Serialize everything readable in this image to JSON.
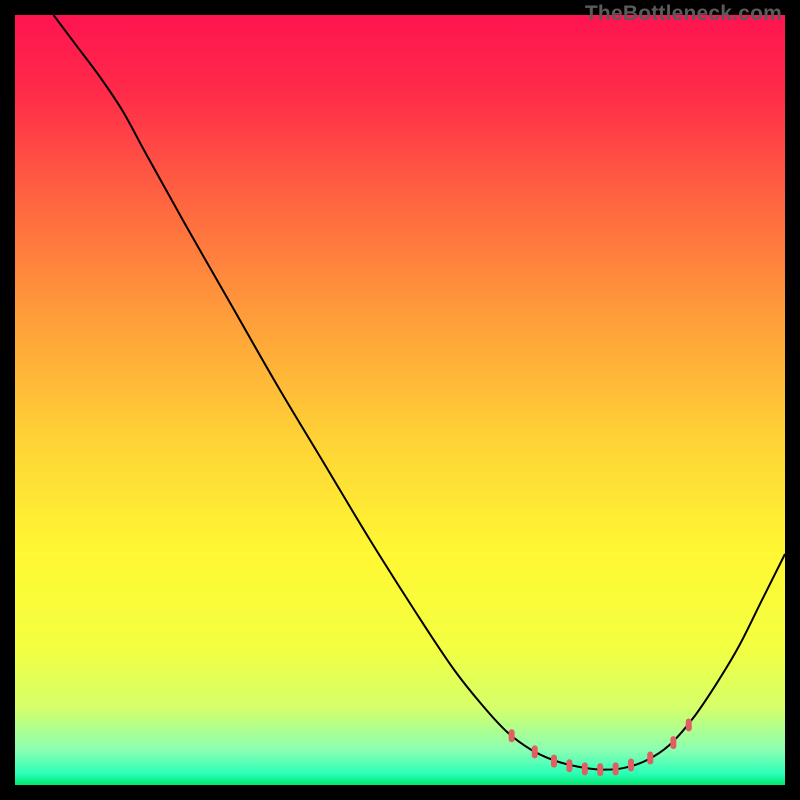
{
  "watermark": "TheBottleneck.com",
  "chart_data": {
    "type": "line",
    "title": "",
    "xlabel": "",
    "ylabel": "",
    "xlim": [
      0,
      100
    ],
    "ylim": [
      0,
      100
    ],
    "gradient_stops": [
      {
        "offset": 0.0,
        "color": "#ff1450"
      },
      {
        "offset": 0.1,
        "color": "#ff2b49"
      },
      {
        "offset": 0.25,
        "color": "#ff6840"
      },
      {
        "offset": 0.4,
        "color": "#ffa03a"
      },
      {
        "offset": 0.55,
        "color": "#ffd236"
      },
      {
        "offset": 0.7,
        "color": "#fff833"
      },
      {
        "offset": 0.82,
        "color": "#f3ff41"
      },
      {
        "offset": 0.9,
        "color": "#d4ff6a"
      },
      {
        "offset": 0.955,
        "color": "#89ffb2"
      },
      {
        "offset": 0.985,
        "color": "#2bffb8"
      },
      {
        "offset": 1.0,
        "color": "#00e86e"
      }
    ],
    "series": [
      {
        "name": "curve",
        "stroke": "#000000",
        "points_xy": [
          [
            5,
            100
          ],
          [
            8,
            96
          ],
          [
            11,
            92
          ],
          [
            14,
            87.5
          ],
          [
            17,
            82
          ],
          [
            22,
            73
          ],
          [
            28,
            62.5
          ],
          [
            34,
            52
          ],
          [
            40,
            42
          ],
          [
            46,
            32
          ],
          [
            52,
            22.5
          ],
          [
            57,
            15
          ],
          [
            61,
            10
          ],
          [
            64,
            6.8
          ],
          [
            67,
            4.6
          ],
          [
            70,
            3.2
          ],
          [
            73,
            2.4
          ],
          [
            76,
            2.0
          ],
          [
            79,
            2.2
          ],
          [
            82,
            3.2
          ],
          [
            85,
            5.2
          ],
          [
            88,
            8.6
          ],
          [
            91,
            13
          ],
          [
            94,
            18
          ],
          [
            97,
            24
          ],
          [
            100,
            30
          ]
        ]
      },
      {
        "name": "fit-band-markers",
        "stroke": "#e06062",
        "marker_r": 5,
        "points_xy": [
          [
            64.5,
            6.4
          ],
          [
            67.5,
            4.3
          ],
          [
            70,
            3.1
          ],
          [
            72,
            2.5
          ],
          [
            74,
            2.1
          ],
          [
            76,
            2.0
          ],
          [
            78,
            2.1
          ],
          [
            80,
            2.6
          ],
          [
            82.5,
            3.5
          ],
          [
            85.5,
            5.5
          ],
          [
            87.5,
            7.8
          ]
        ]
      }
    ]
  }
}
